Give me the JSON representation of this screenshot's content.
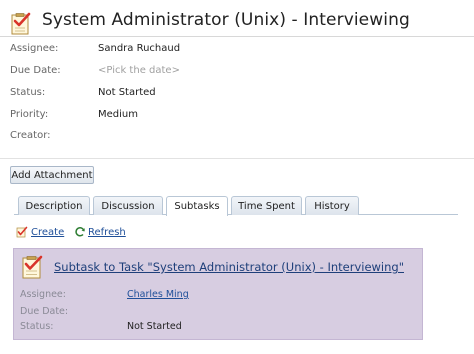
{
  "task": {
    "title": "System Administrator (Unix) - Interviewing",
    "fields": [
      {
        "label": "Assignee:",
        "value": "Sandra Ruchaud",
        "placeholder": false
      },
      {
        "label": "Due Date:",
        "value": "<Pick the date>",
        "placeholder": true
      },
      {
        "label": "Status:",
        "value": "Not Started",
        "placeholder": false
      },
      {
        "label": "Priority:",
        "value": "Medium",
        "placeholder": false
      },
      {
        "label": "Creator:",
        "value": "",
        "placeholder": false
      }
    ]
  },
  "actions": {
    "add_attachment_label": "Add Attachment"
  },
  "tabs": [
    {
      "label": "Description",
      "active": false
    },
    {
      "label": "Discussion",
      "active": false
    },
    {
      "label": "Subtasks",
      "active": true
    },
    {
      "label": "Time Spent",
      "active": false
    },
    {
      "label": "History",
      "active": false
    }
  ],
  "subtasks_toolbar": {
    "create_label": "Create",
    "refresh_label": "Refresh"
  },
  "subtask": {
    "title": "Subtask to Task \"System Administrator (Unix) - Interviewing\"",
    "fields": [
      {
        "label": "Assignee:",
        "value": "Charles Ming",
        "link": true
      },
      {
        "label": "Due Date:",
        "value": "",
        "link": false
      },
      {
        "label": "Status:",
        "value": "Not Started",
        "link": false
      }
    ]
  },
  "colors": {
    "subtask_panel_bg": "#d7cde1",
    "link": "#1f4f99",
    "checkmark": "#d9342b"
  },
  "icons": {
    "task": "task-checklist-icon",
    "create": "create-task-icon",
    "refresh": "refresh-icon"
  }
}
